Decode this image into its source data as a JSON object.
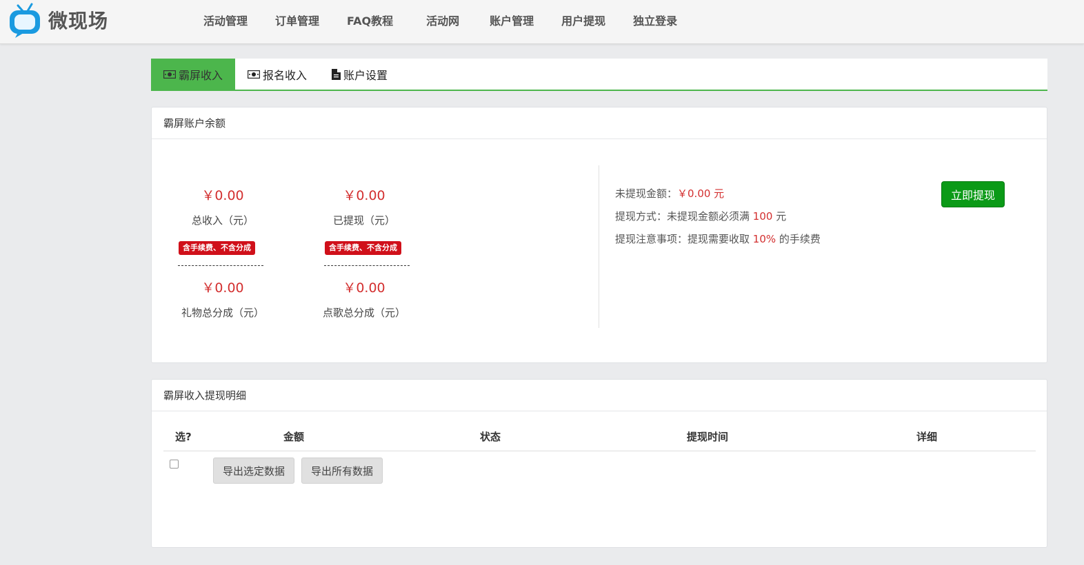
{
  "header": {
    "logo_text": "微现场",
    "nav": [
      "活动管理",
      "订单管理",
      "FAQ教程",
      "活动网",
      "账户管理",
      "用户提现",
      "独立登录"
    ]
  },
  "tabs": [
    {
      "label": "霸屏收入",
      "icon": "cash-icon",
      "active": true
    },
    {
      "label": "报名收入",
      "icon": "cash-icon",
      "active": false
    },
    {
      "label": "账户设置",
      "icon": "document-icon",
      "active": false
    }
  ],
  "balance_panel": {
    "title": "霸屏账户余额",
    "stats": {
      "total_income": {
        "value": "￥0.00",
        "label": "总收入（元）",
        "badge": "含手续费、不含分成"
      },
      "withdrawn": {
        "value": "￥0.00",
        "label": "已提现（元）",
        "badge": "含手续费、不含分成"
      },
      "gift_share": {
        "value": "￥0.00",
        "label": "礼物总分成（元）"
      },
      "song_share": {
        "value": "￥0.00",
        "label": "点歌总分成（元）"
      }
    },
    "info": {
      "pending_label": "未提现金额：",
      "pending_value": "￥0.00 元",
      "method_label": "提现方式：未提现金额必须满",
      "method_value": "100",
      "method_unit": "元",
      "notice_label": "提现注意事项：提现需要收取",
      "notice_value": "10%",
      "notice_suffix": "的手续费"
    },
    "withdraw_button": "立即提现"
  },
  "detail_panel": {
    "title": "霸屏收入提现明细",
    "columns": [
      "选?",
      "金额",
      "状态",
      "提现时间",
      "详细"
    ],
    "export_selected": "导出选定数据",
    "export_all": "导出所有数据"
  },
  "colors": {
    "accent_green": "#4cb64c",
    "button_green": "#0b9a17",
    "money_red": "#d32f2f",
    "badge_red": "#d0101a"
  }
}
